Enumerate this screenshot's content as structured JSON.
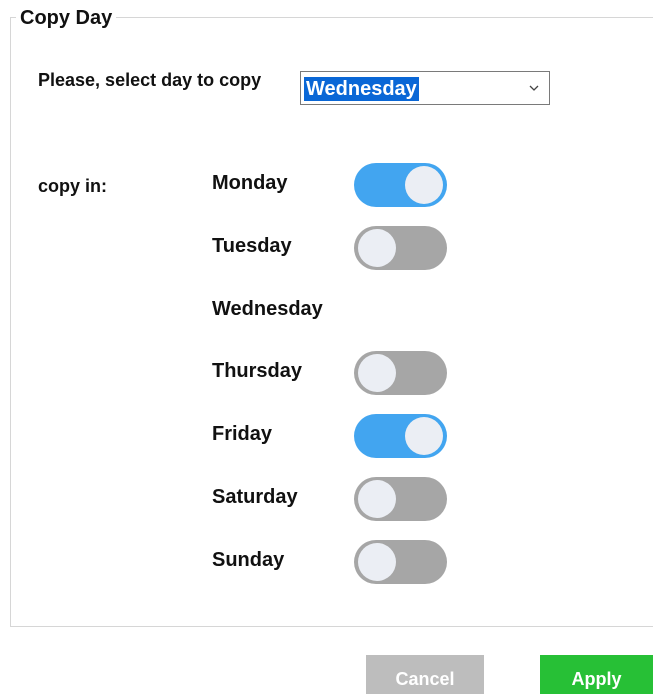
{
  "dialog": {
    "group_title": "Copy Day",
    "select_label": "Please, select day to copy",
    "selected_day": "Wednesday",
    "copy_in_label": "copy in:"
  },
  "days": [
    {
      "label": "Monday",
      "has_toggle": true,
      "on": true
    },
    {
      "label": "Tuesday",
      "has_toggle": true,
      "on": false
    },
    {
      "label": "Wednesday",
      "has_toggle": false,
      "on": false
    },
    {
      "label": "Thursday",
      "has_toggle": true,
      "on": false
    },
    {
      "label": "Friday",
      "has_toggle": true,
      "on": true
    },
    {
      "label": "Saturday",
      "has_toggle": true,
      "on": false
    },
    {
      "label": "Sunday",
      "has_toggle": true,
      "on": false
    }
  ],
  "buttons": {
    "cancel_label": "Cancel",
    "apply_label": "Apply"
  },
  "colors": {
    "toggle_on": "#42a5f0",
    "toggle_off": "#a6a6a6",
    "apply": "#27c036",
    "cancel": "#bdbdbd",
    "selection_highlight": "#0a67d6"
  },
  "icons": {
    "select_arrow": "chevron-down-icon"
  }
}
